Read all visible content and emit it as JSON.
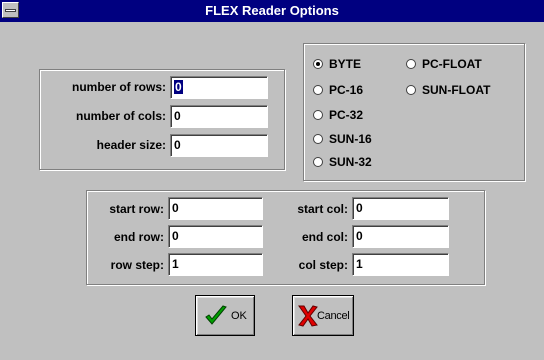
{
  "window": {
    "title": "FLEX Reader Options"
  },
  "dimensions": {
    "rows_label": "number of rows:",
    "rows_value": "0",
    "cols_label": "number of cols:",
    "cols_value": "0",
    "header_label": "header size:",
    "header_value": "0"
  },
  "format": {
    "options": [
      "BYTE",
      "PC-16",
      "PC-32",
      "SUN-16",
      "SUN-32",
      "PC-FLOAT",
      "SUN-FLOAT"
    ],
    "selected": "BYTE"
  },
  "range": {
    "start_row_label": "start row:",
    "start_row_value": "0",
    "end_row_label": "end row:",
    "end_row_value": "0",
    "row_step_label": "row step:",
    "row_step_value": "1",
    "start_col_label": "start col:",
    "start_col_value": "0",
    "end_col_label": "end col:",
    "end_col_value": "0",
    "col_step_label": "col step:",
    "col_step_value": "1"
  },
  "buttons": {
    "ok_label": "OK",
    "cancel_label": "Cancel",
    "ok_icon": "checkmark-icon",
    "cancel_icon": "red-x-icon"
  },
  "colors": {
    "titlebar": "#000080",
    "dialog": "#c0c0c0",
    "check": "#00a000",
    "cross": "#e00000"
  }
}
